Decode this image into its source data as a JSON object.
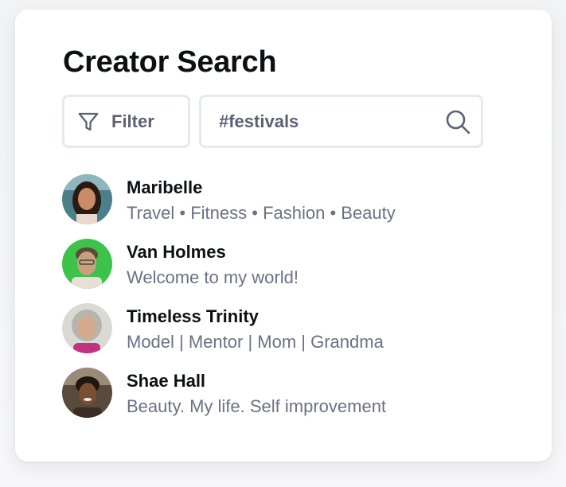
{
  "title": "Creator Search",
  "filter": {
    "label": "Filter",
    "icon": "filter-icon"
  },
  "search": {
    "value": "#festivals",
    "placeholder": "",
    "icon": "search-icon"
  },
  "creators": [
    {
      "name": "Maribelle",
      "bio": "Travel • Fitness • Fashion • Beauty",
      "avatar_bg": "#4d7f8a"
    },
    {
      "name": "Van Holmes",
      "bio": "Welcome to my world!",
      "avatar_bg": "#3dc24a"
    },
    {
      "name": "Timeless Trinity",
      "bio": "Model | Mentor | Mom | Grandma",
      "avatar_bg": "#d9dad6"
    },
    {
      "name": "Shae Hall",
      "bio": "Beauty. My life. Self improvement",
      "avatar_bg": "#5a4a3c"
    }
  ],
  "colors": {
    "text_primary": "#0d0f14",
    "text_secondary": "#6b7185",
    "border": "#e6e9ef"
  }
}
